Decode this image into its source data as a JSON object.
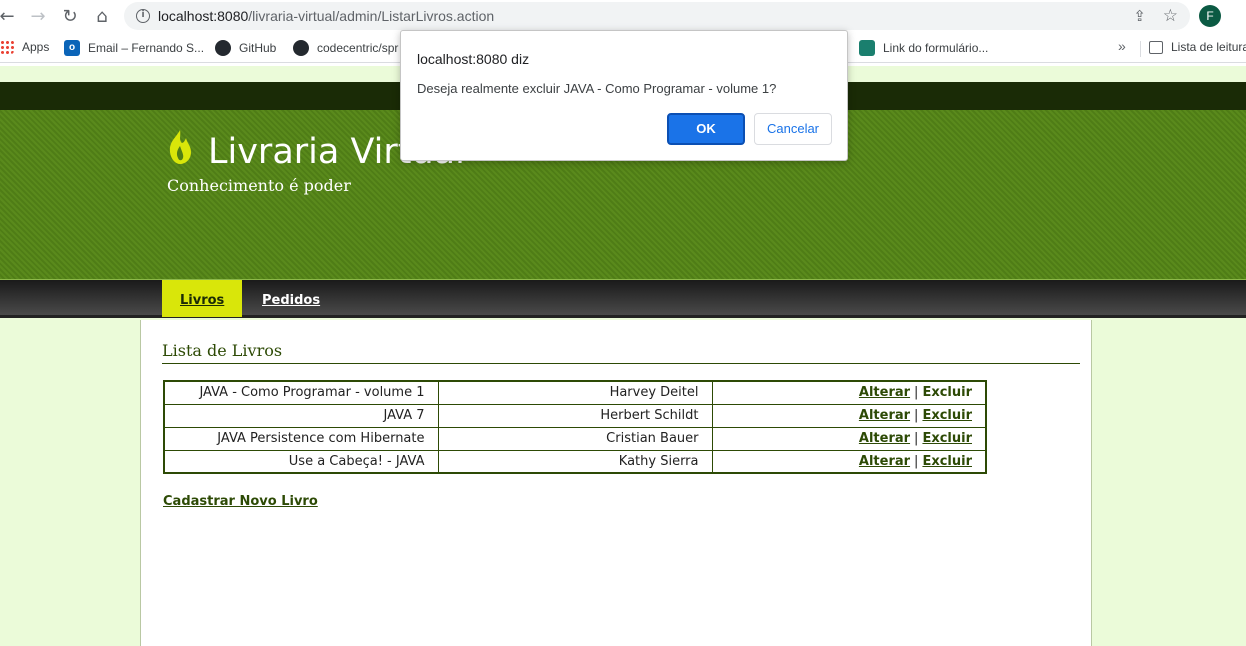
{
  "browser": {
    "url_host": "localhost:8080",
    "url_path": "/livraria-virtual/admin/ListarLivros.action",
    "profile_initial": "F",
    "bookmarks": [
      {
        "label": "Apps",
        "icon": "apps-grid-icon"
      },
      {
        "label": "Email – Fernando S...",
        "icon": "outlook-icon"
      },
      {
        "label": "GitHub",
        "icon": "github-icon"
      },
      {
        "label": "codecentric/spr",
        "icon": "github-icon"
      },
      {
        "label": "Link do formulário...",
        "icon": "forms-icon"
      },
      {
        "label": "Lista de leitura",
        "icon": "reading-list-icon"
      }
    ],
    "more_bookmarks": "»"
  },
  "site": {
    "title": "Livraria Virtual",
    "slogan": "Conhecimento é poder",
    "menu": [
      {
        "label": "Livros",
        "active": true
      },
      {
        "label": "Pedidos",
        "active": false
      }
    ],
    "accent_color": "#d9e60a",
    "primary_color": "#2d4a05"
  },
  "main": {
    "heading": "Lista de Livros",
    "books": [
      {
        "title": "JAVA - Como Programar - volume 1",
        "author": "Harvey Deitel",
        "edit": "Alterar",
        "sep": "|",
        "delete": "Excluir"
      },
      {
        "title": "JAVA 7",
        "author": "Herbert Schildt",
        "edit": "Alterar",
        "sep": "|",
        "delete": "Excluir"
      },
      {
        "title": "JAVA Persistence com Hibernate",
        "author": "Cristian Bauer",
        "edit": "Alterar",
        "sep": "|",
        "delete": "Excluir"
      },
      {
        "title": "Use a Cabeça! - JAVA",
        "author": "Kathy Sierra",
        "edit": "Alterar",
        "sep": "|",
        "delete": "Excluir"
      }
    ],
    "new_book_link": "Cadastrar Novo Livro"
  },
  "dialog": {
    "origin": "localhost:8080 diz",
    "message": "Deseja realmente excluir JAVA - Como Programar - volume 1?",
    "ok_label": "OK",
    "cancel_label": "Cancelar"
  }
}
